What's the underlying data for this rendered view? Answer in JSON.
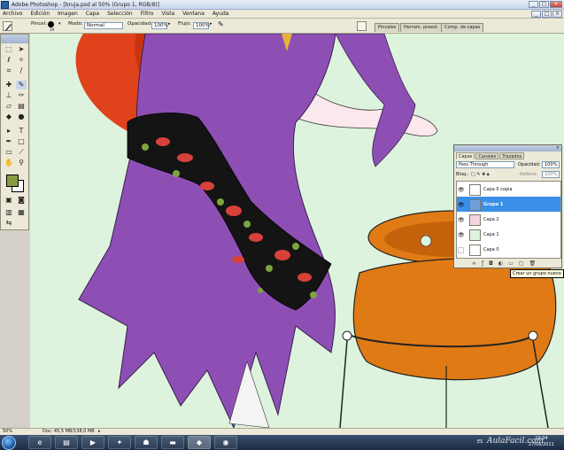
{
  "window": {
    "title": "Adobe Photoshop - [bruja.psd al 50% (Grupo 1, RGB/8)]",
    "buttons": [
      "_",
      "□",
      "×"
    ]
  },
  "menu": [
    "Archivo",
    "Edición",
    "Imagen",
    "Capa",
    "Selección",
    "Filtro",
    "Vista",
    "Ventana",
    "Ayuda"
  ],
  "options": {
    "brush_label": "Pincel:",
    "brush_size": "19",
    "mode_label": "Modo:",
    "mode_value": "Normal",
    "opacity_label": "Opacidad:",
    "opacity_value": "100%",
    "flow_label": "Flujo:",
    "flow_value": "100%"
  },
  "palette_well": [
    "Pinceles",
    "Herram. preest.",
    "Comp. de capas"
  ],
  "toolbox": {
    "foreground_color": "#859c40",
    "background_color": "#ffffff",
    "tools": [
      "marquee-icon",
      "move-icon",
      "lasso-icon",
      "magic-wand-icon",
      "crop-icon",
      "slice-icon",
      "healing-icon",
      "brush-icon",
      "stamp-icon",
      "history-brush-icon",
      "eraser-icon",
      "gradient-icon",
      "blur-icon",
      "dodge-icon",
      "path-select-icon",
      "type-icon",
      "pen-icon",
      "shape-icon",
      "notes-icon",
      "eyedropper-icon",
      "hand-icon",
      "zoom-icon"
    ]
  },
  "layers_panel": {
    "tabs": [
      "Capas",
      "Canales",
      "Trazados"
    ],
    "blend_mode": "Pass Through",
    "opacity_label": "Opacidad:",
    "opacity_value": "100%",
    "lock_label": "Bloq.:",
    "fill_label": "Relleno:",
    "fill_value": "100%",
    "layers": [
      {
        "name": "Capa 0 copia",
        "visible": true,
        "selected": false
      },
      {
        "name": "Grupo 1",
        "visible": true,
        "selected": true
      },
      {
        "name": "Capa 2",
        "visible": true,
        "selected": false
      },
      {
        "name": "Capa 1",
        "visible": true,
        "selected": false
      },
      {
        "name": "Capa 0",
        "visible": false,
        "selected": false
      }
    ],
    "tooltip": "Crear un grupo nuevo"
  },
  "statusbar": {
    "zoom": "50%",
    "doc_info": "Doc: 45,5 MB/138,0 MB"
  },
  "taskbar": {
    "language": "ES",
    "time": "19:04",
    "date": "27/06/2011",
    "watermark": "AulaFacil.com"
  },
  "colors": {
    "canvas_bg": "#ddf3dd",
    "dress": "#8e4fb4",
    "hair": "#e0421c",
    "pot": "#e07a15",
    "apron": "#141414",
    "selected_layer": "#3a8fe8"
  }
}
